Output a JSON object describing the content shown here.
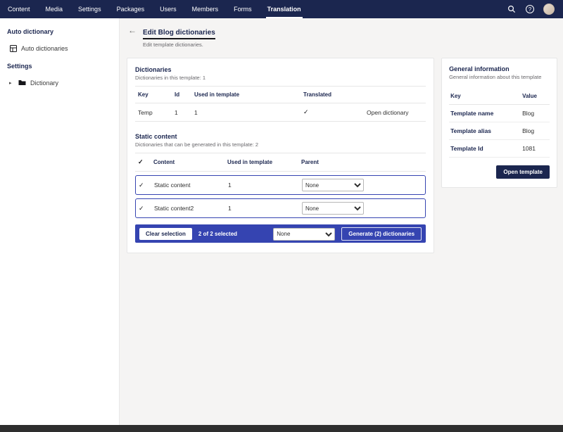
{
  "icons": {
    "check": "✓",
    "back": "←",
    "help": "?",
    "tree_caret": "▸"
  },
  "topnav": {
    "items": [
      {
        "label": "Content"
      },
      {
        "label": "Media"
      },
      {
        "label": "Settings"
      },
      {
        "label": "Packages"
      },
      {
        "label": "Users"
      },
      {
        "label": "Members"
      },
      {
        "label": "Forms"
      },
      {
        "label": "Translation"
      }
    ]
  },
  "sidebar": {
    "sections": [
      {
        "header": "Auto dictionary",
        "items": [
          {
            "label": "Auto dictionaries"
          }
        ]
      },
      {
        "header": "Settings",
        "items": [
          {
            "label": "Dictionary"
          }
        ]
      }
    ]
  },
  "page": {
    "title": "Edit Blog dictionaries",
    "subtitle": "Edit template dictionaries."
  },
  "dictionaries": {
    "title": "Dictionaries",
    "subtitle": "Dictionaries in this template: 1",
    "columns": [
      "Key",
      "Id",
      "Used in template",
      "Translated"
    ],
    "rows": [
      {
        "key": "Temp",
        "id": "1",
        "used": "1",
        "translated": "✓",
        "action": "Open dictionary"
      }
    ]
  },
  "static_content": {
    "title": "Static content",
    "subtitle": "Dictionaries that can be generated in this template: 2",
    "columns": [
      "Content",
      "Used in template",
      "Parent"
    ],
    "rows": [
      {
        "content": "Static content",
        "used": "1",
        "parent": "None"
      },
      {
        "content": "Static content2",
        "used": "1",
        "parent": "None"
      }
    ],
    "selection_bar": {
      "clear_label": "Clear selection",
      "selected_text": "2 of 2 selected",
      "parent_select": "None",
      "generate_label": "Generate (2) dictionaries"
    }
  },
  "general_info": {
    "title": "General information",
    "subtitle": "General information about this template",
    "columns": [
      "Key",
      "Value"
    ],
    "rows": [
      {
        "key": "Template name",
        "value": "Blog"
      },
      {
        "key": "Template alias",
        "value": "Blog"
      },
      {
        "key": "Template Id",
        "value": "1081"
      }
    ],
    "open_template_label": "Open template"
  }
}
